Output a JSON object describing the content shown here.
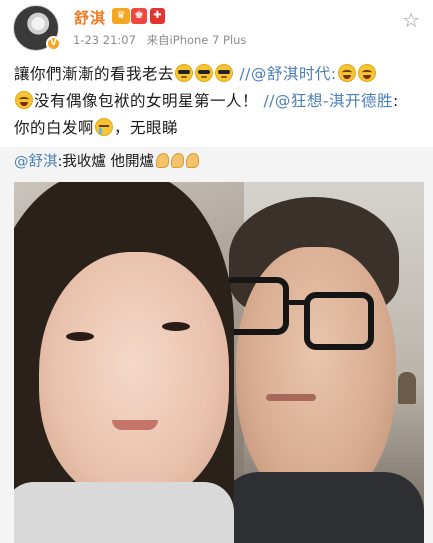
{
  "post": {
    "username": "舒淇",
    "time": "1-23 21:07",
    "source": "来自iPhone 7 Plus",
    "follow_icon": "star-icon",
    "text": {
      "line1_prefix": "讓你們漸漸的看我老去",
      "mention1": "//@舒淇时代:",
      "line2_text": "没有偶像包袱的女明星第一人！",
      "mention2": "//@狂想-淇开德胜",
      "line3_prefix": ":",
      "line3_text": "你的白发啊",
      "line3_suffix": "，无眼睇"
    }
  },
  "retweet": {
    "mention": "@舒淇",
    "text": ":我收爐 他開爐"
  },
  "colors": {
    "username": "#f07a1f",
    "mention": "#4b7fb8",
    "retweet_bg": "#f4f4f4"
  }
}
